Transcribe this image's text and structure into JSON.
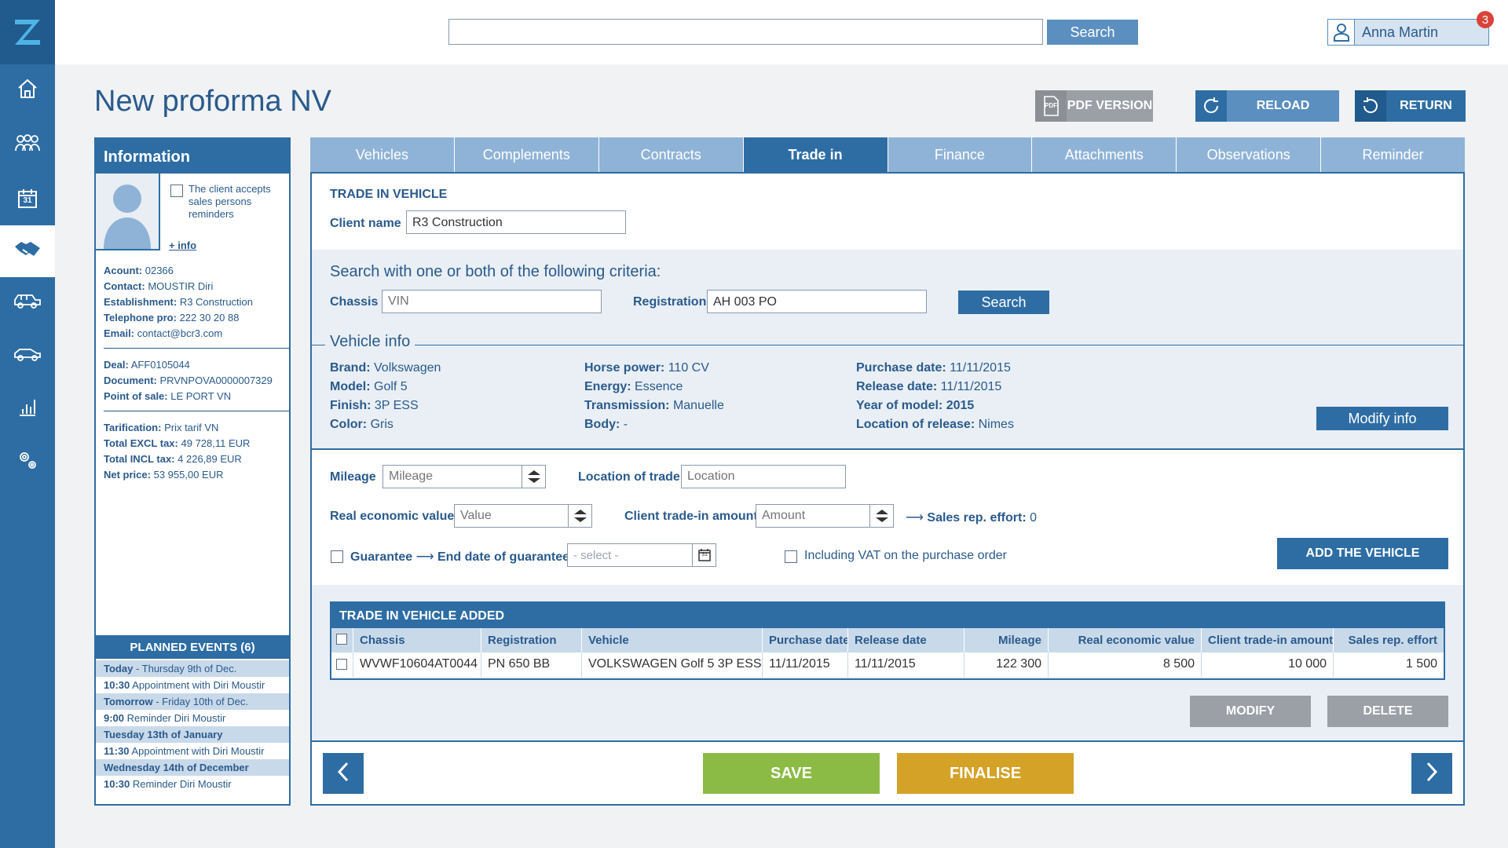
{
  "app": {
    "logo": "Z"
  },
  "sidebar": {
    "items": [
      {
        "name": "home-icon"
      },
      {
        "name": "people-icon"
      },
      {
        "name": "calendar-icon",
        "text": "31"
      },
      {
        "name": "handshake-icon",
        "active": true
      },
      {
        "name": "fleet-icon"
      },
      {
        "name": "car-icon"
      },
      {
        "name": "chart-icon"
      },
      {
        "name": "settings-icon"
      }
    ]
  },
  "topbar": {
    "search_placeholder": "",
    "search_label": "Search",
    "user_name": "Anna Martin",
    "notifications": "3"
  },
  "page": {
    "title": "New proforma NV"
  },
  "actions": {
    "pdf_icon_text": "PDF",
    "pdf": "PDF VERSION",
    "reload": "RELOAD",
    "return": "RETURN"
  },
  "info": {
    "header": "Information",
    "consent": "The client accepts sales persons reminders",
    "more_info": "+ info",
    "account_label": "Acount:",
    "account": "02366",
    "contact_label": "Contact:",
    "contact": "MOUSTIR Diri",
    "establishment_label": "Establishment:",
    "establishment": "R3 Construction",
    "telephone_label": "Telephone pro:",
    "telephone": "222 30 20 88",
    "email_label": "Email:",
    "email": "contact@bcr3.com",
    "deal_label": "Deal:",
    "deal": "AFF0105044",
    "document_label": "Document:",
    "document": "PRVNPOVA0000007329",
    "pos_label": "Point of sale:",
    "pos": "LE PORT VN",
    "tarif_label": "Tarification:",
    "tarif": "Prix tarif VN",
    "excl_label": "Total EXCL tax:",
    "excl": "49 728,11 EUR",
    "incl_label": "Total INCL tax:",
    "incl": "4 226,89 EUR",
    "net_label": "Net price:",
    "net": "53 955,00 EUR"
  },
  "events": {
    "header": "PLANNED EVENTS (6)",
    "items": [
      {
        "bold": "Today",
        "text": " - Thursday 9th of Dec.",
        "day": true
      },
      {
        "bold": "10:30",
        "text": " Appointment with Diri Moustir",
        "day": false
      },
      {
        "bold": "Tomorrow",
        "text": " - Friday 10th of Dec.",
        "day": true
      },
      {
        "bold": "9:00",
        "text": " Reminder Diri Moustir",
        "day": false
      },
      {
        "bold": "Tuesday 13th of January",
        "text": "",
        "day": true
      },
      {
        "bold": "11:30",
        "text": " Appointment with Diri Moustir",
        "day": false
      },
      {
        "bold": "Wednesday 14th of December",
        "text": "",
        "day": true
      },
      {
        "bold": "10:30",
        "text": " Reminder Diri Moustir",
        "day": false
      }
    ]
  },
  "tabs": [
    "Vehicles",
    "Complements",
    "Contracts",
    "Trade in",
    "Finance",
    "Attachments",
    "Observations",
    "Reminder"
  ],
  "active_tab": "Trade in",
  "trade": {
    "section": "TRADE IN VEHICLE",
    "client_label": "Client name",
    "client_value": "R3 Construction",
    "criteria": "Search with one or both of the following criteria:",
    "chassis_label": "Chassis",
    "chassis_placeholder": "VIN",
    "registration_label": "Registration",
    "registration_value": "AH 003 PO",
    "search_label": "Search",
    "vehicle_info": "Vehicle info",
    "brand_label": "Brand:",
    "brand": "Volkswagen",
    "model_label": "Model:",
    "model": "Golf 5",
    "finish_label": "Finish:",
    "finish": "3P ESS",
    "color_label": "Color:",
    "color": "Gris",
    "hp_label": "Horse power:",
    "hp": "110 CV",
    "energy_label": "Energy:",
    "energy": "Essence",
    "trans_label": "Transmission:",
    "trans": "Manuelle",
    "body_label": "Body:",
    "body": "-",
    "purchase_label": "Purchase date:",
    "purchase": "11/11/2015",
    "release_label": "Release date:",
    "release": "11/11/2015",
    "yom_label": "Year of model:",
    "yom": "2015",
    "lor_label": "Location of release:",
    "lor": "Nimes",
    "modify_info": "Modify info",
    "mileage_label": "Mileage",
    "mileage_placeholder": "Mileage",
    "location_label": "Location of trade",
    "location_placeholder": "Location",
    "rev_label": "Real economic value",
    "rev_placeholder": "Value",
    "cta_label": "Client trade-in amount",
    "cta_placeholder": "Amount",
    "effort_label": "Sales rep. effort:",
    "effort": "0",
    "guarantee_label": "Guarantee",
    "end_guarantee_label": "End date of guarantee",
    "select_placeholder": "- select -",
    "calendar_text": "31",
    "vat_label": "Including VAT on the purchase order",
    "add_vehicle": "ADD THE VEHICLE"
  },
  "table": {
    "title": "TRADE IN VEHICLE ADDED",
    "headers": [
      "Chassis",
      "Registration",
      "Vehicle",
      "Purchase date",
      "Release date",
      "Mileage",
      "Real economic value",
      "Client trade-in amount",
      "Sales rep. effort"
    ],
    "rows": [
      [
        "WVWF10604AT0044",
        "PN 650 BB",
        "VOLKSWAGEN Golf 5 3P ESS",
        "11/11/2015",
        "11/11/2015",
        "122 300",
        "8 500",
        "10 000",
        "1 500"
      ]
    ]
  },
  "table_actions": {
    "modify": "MODIFY",
    "delete": "DELETE"
  },
  "footer": {
    "save": "SAVE",
    "finalise": "FINALISE"
  },
  "colors": {
    "primary": "#2e6da4",
    "light": "#8fb3d6",
    "save": "#8cbb45",
    "finalise": "#d4a227",
    "gray": "#9aa0a6",
    "badge": "#d9433a"
  }
}
